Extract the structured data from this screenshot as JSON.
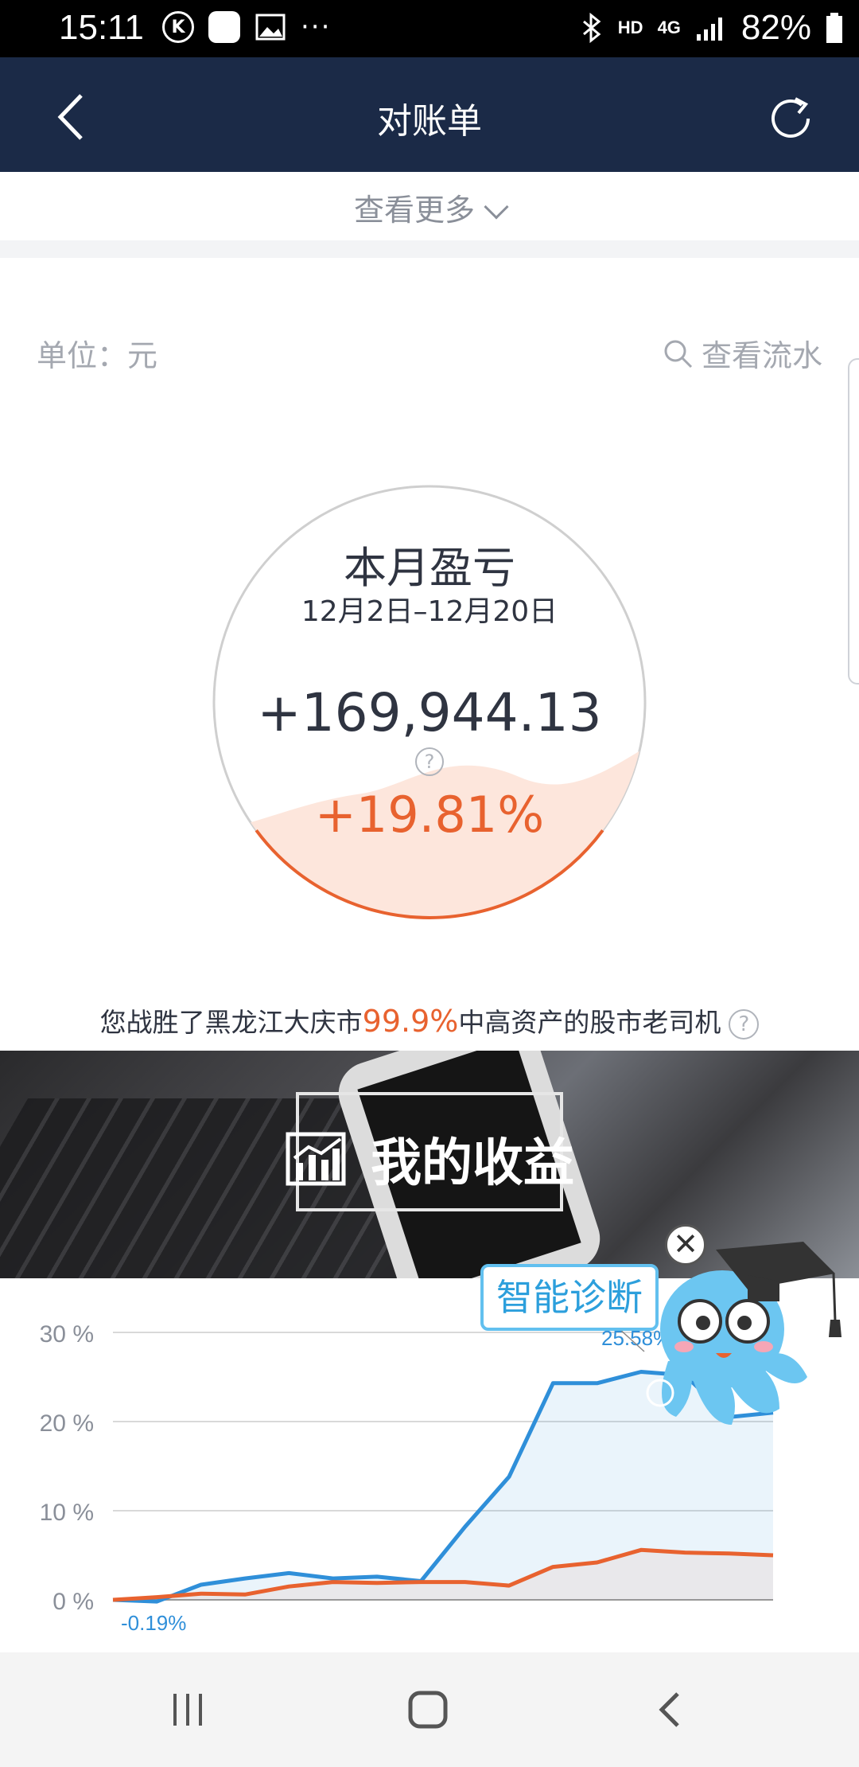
{
  "status_bar": {
    "time": "15:11",
    "network": "HD",
    "signal": "4G",
    "battery": "82%"
  },
  "header": {
    "title": "对账单"
  },
  "more": {
    "label": "查看更多"
  },
  "summary": {
    "unit": "单位：元",
    "flow_label": "查看流水",
    "title": "本月盈亏",
    "date_range": "12月2日–12月20日",
    "amount": "+169,944.13",
    "help": "?",
    "percent": "+19.81%",
    "progress_fraction": 0.1981
  },
  "beat": {
    "prefix": "您战胜了黑龙江大庆市",
    "highlight": "99.9%",
    "suffix": "中高资产的股市老司机"
  },
  "banner": {
    "label": "我的收益"
  },
  "diagnosis": {
    "label": "智能诊断"
  },
  "chart_data": {
    "type": "line",
    "yticks": [
      "30 %",
      "20 %",
      "10 %",
      "0 %"
    ],
    "ylim": [
      0,
      30
    ],
    "annotations": [
      "25.58%",
      "-0.19%"
    ],
    "series": [
      {
        "color": "#2f8fd9",
        "values": [
          0,
          -0.19,
          1.7,
          2.4,
          3.0,
          2.4,
          2.6,
          2.1,
          8.2,
          13.8,
          24.3,
          24.3,
          25.58,
          25.2,
          20.5,
          21.0
        ]
      },
      {
        "color": "#e8622f",
        "values": [
          0,
          0.3,
          0.7,
          0.6,
          1.5,
          2.0,
          1.9,
          2.0,
          2.0,
          1.6,
          3.7,
          4.2,
          5.6,
          5.3,
          5.2,
          5.0
        ]
      }
    ]
  },
  "colors": {
    "accent": "#e8622f",
    "nav": "#1b2a47",
    "blue": "#2f8fd9"
  }
}
